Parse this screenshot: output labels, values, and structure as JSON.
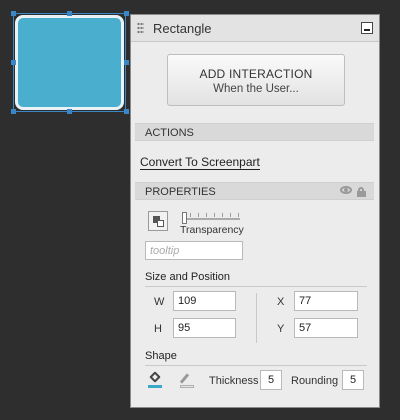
{
  "panel": {
    "title": "Rectangle",
    "add_interaction": {
      "line1": "ADD INTERACTION",
      "line2": "When the User..."
    },
    "actions": {
      "header": "ACTIONS",
      "convert_link": "Convert To Screenpart"
    },
    "properties": {
      "header": "PROPERTIES",
      "transparency_label": "Transparency",
      "transparency_value": 0,
      "tooltip_placeholder": "tooltip",
      "size_position": {
        "title": "Size and Position",
        "w_label": "W",
        "w_value": "109",
        "h_label": "H",
        "h_value": "95",
        "x_label": "X",
        "x_value": "77",
        "y_label": "Y",
        "y_value": "57"
      },
      "shape": {
        "title": "Shape",
        "thickness_label": "Thickness",
        "thickness_value": "5",
        "rounding_label": "Rounding",
        "rounding_value": "5",
        "fill_color": "#3ba7c9"
      }
    }
  },
  "canvas": {
    "shape_fill": "#4aaecf"
  },
  "icons": {
    "drag": "grip-icon",
    "minimize": "minimize-icon",
    "visibility": "eye-icon",
    "lock": "lock-icon",
    "color": "color-square-icon",
    "fill": "fill-bucket-icon",
    "line": "line-color-icon"
  }
}
